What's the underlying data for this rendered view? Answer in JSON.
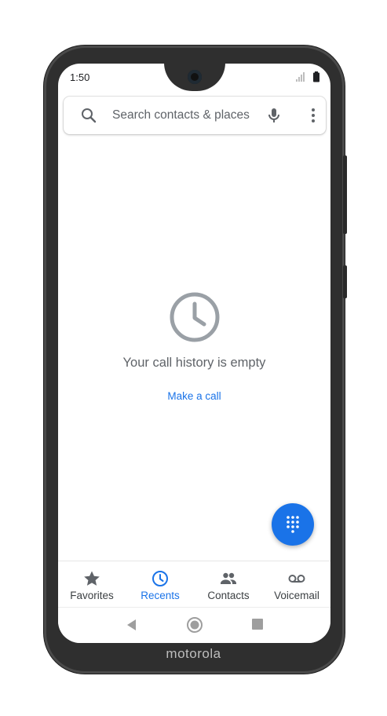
{
  "status_bar": {
    "time": "1:50"
  },
  "search": {
    "placeholder": "Search contacts & places"
  },
  "empty_state": {
    "message": "Your call history is empty",
    "action_label": "Make a call"
  },
  "bottom_nav": {
    "tabs": [
      {
        "label": "Favorites",
        "icon": "star-icon",
        "active": false
      },
      {
        "label": "Recents",
        "icon": "clock-icon",
        "active": true
      },
      {
        "label": "Contacts",
        "icon": "people-icon",
        "active": false
      },
      {
        "label": "Voicemail",
        "icon": "voicemail-icon",
        "active": false
      }
    ]
  },
  "device": {
    "brand": "motorola"
  },
  "colors": {
    "accent": "#1a73e8",
    "text_secondary": "#5f6368",
    "icon_gray": "#9aa0a6"
  }
}
